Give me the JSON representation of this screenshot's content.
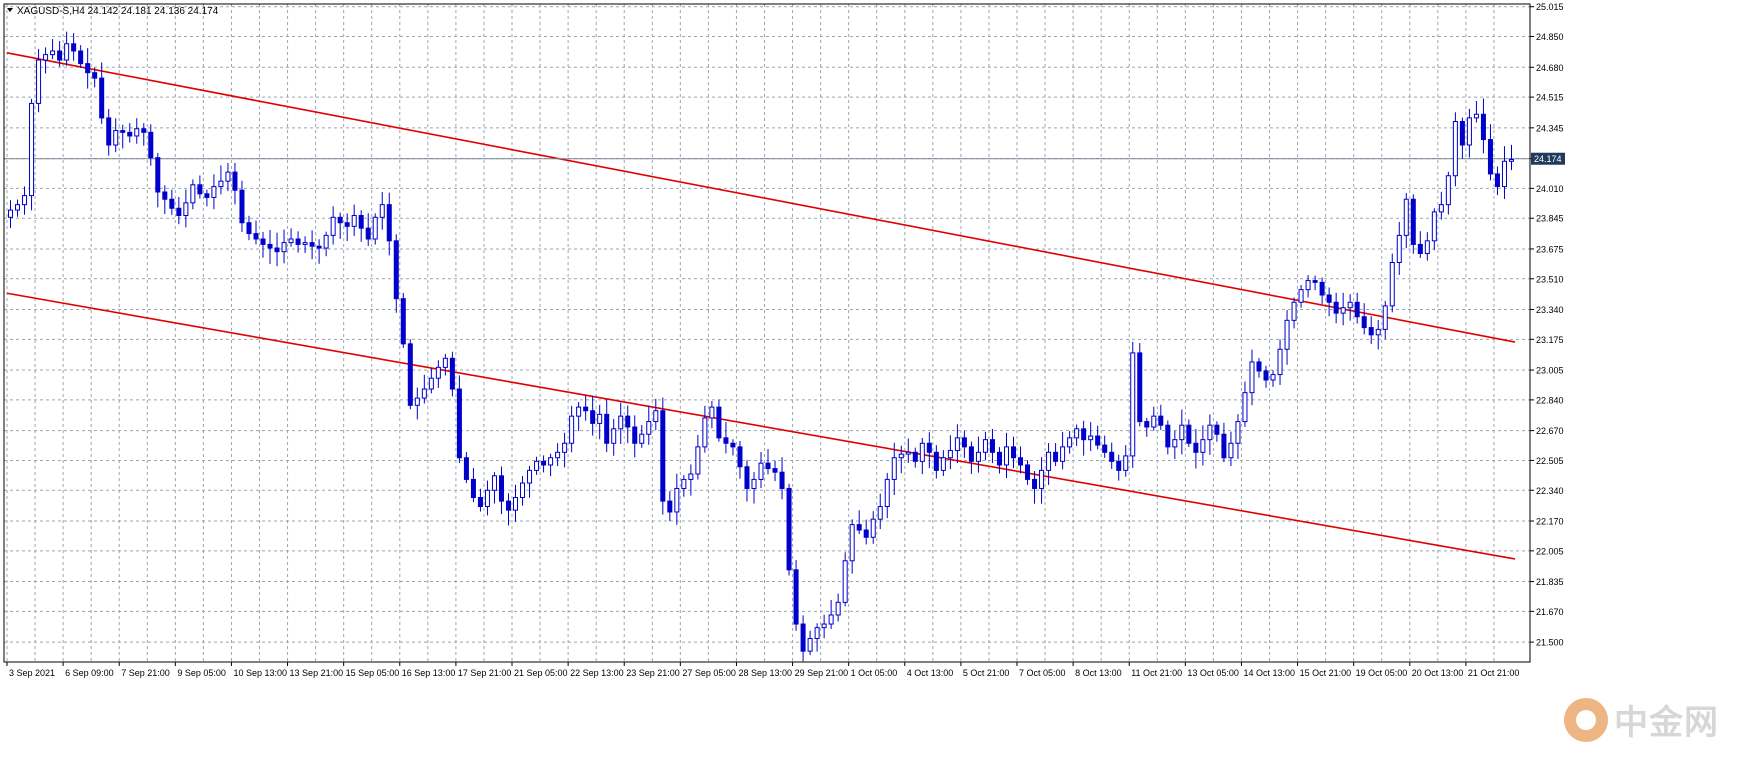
{
  "header": {
    "symbol_text": "XAGUSD-S,H4  24.142 24.181 24.136 24.174",
    "arrow": "triangle-down-icon"
  },
  "current_price_label": "24.174",
  "watermark": {
    "text": "中金网",
    "logo": "cngold-logo-icon"
  },
  "colors": {
    "background": "#ffffff",
    "grid": "#9aa5b1",
    "candle": "#0000cc",
    "trendline": "#e00000",
    "price_line": "#7a8696",
    "price_label_bg": "#1f3a5a",
    "axis_text": "#000000"
  },
  "chart_data": {
    "type": "candlestick",
    "title": "",
    "xlabel": "",
    "ylabel": "",
    "ylim": [
      21.39,
      25.03
    ],
    "grid": true,
    "y_ticks": [
      "25.015",
      "24.850",
      "24.680",
      "24.515",
      "24.345",
      "24.175",
      "24.010",
      "23.845",
      "23.675",
      "23.510",
      "23.340",
      "23.175",
      "23.005",
      "22.840",
      "22.670",
      "22.505",
      "22.340",
      "22.170",
      "22.005",
      "21.835",
      "21.670",
      "21.500"
    ],
    "x_ticks": [
      "3 Sep 2021",
      "6 Sep 09:00",
      "7 Sep 21:00",
      "9 Sep 05:00",
      "10 Sep 13:00",
      "13 Sep 21:00",
      "15 Sep 05:00",
      "16 Sep 13:00",
      "17 Sep 21:00",
      "21 Sep 05:00",
      "22 Sep 13:00",
      "23 Sep 21:00",
      "27 Sep 05:00",
      "28 Sep 13:00",
      "29 Sep 21:00",
      "1 Oct 05:00",
      "4 Oct 13:00",
      "5 Oct 21:00",
      "7 Oct 05:00",
      "8 Oct 13:00",
      "11 Oct 21:00",
      "13 Oct 05:00",
      "14 Oct 13:00",
      "15 Oct 21:00",
      "19 Oct 05:00",
      "20 Oct 13:00",
      "21 Oct 21:00"
    ],
    "x_tick_bar_index": [
      0,
      8,
      16,
      24,
      32,
      40,
      48,
      56,
      64,
      72,
      80,
      88,
      96,
      104,
      112,
      120,
      128,
      136,
      144,
      152,
      160,
      168,
      176,
      184,
      192,
      200,
      208
    ],
    "current_price": 24.174,
    "trendlines": [
      {
        "from": [
          0,
          24.76
        ],
        "to": [
          215,
          23.16
        ]
      },
      {
        "from": [
          0,
          23.43
        ],
        "to": [
          215,
          21.96
        ]
      }
    ],
    "closes": [
      23.89,
      23.92,
      23.97,
      24.48,
      24.72,
      24.75,
      24.77,
      24.72,
      24.81,
      24.77,
      24.7,
      24.65,
      24.62,
      24.4,
      24.25,
      24.33,
      24.32,
      24.3,
      24.34,
      24.32,
      24.18,
      23.99,
      23.95,
      23.9,
      23.86,
      23.93,
      24.03,
      23.98,
      23.96,
      24.02,
      24.05,
      24.1,
      24.0,
      23.82,
      23.76,
      23.73,
      23.7,
      23.68,
      23.66,
      23.71,
      23.73,
      23.7,
      23.71,
      23.69,
      23.68,
      23.75,
      23.85,
      23.82,
      23.8,
      23.86,
      23.79,
      23.73,
      23.85,
      23.92,
      23.72,
      23.4,
      23.15,
      22.81,
      22.85,
      22.9,
      22.96,
      23.02,
      23.07,
      22.9,
      22.52,
      22.4,
      22.3,
      22.25,
      22.34,
      22.42,
      22.28,
      22.23,
      22.3,
      22.38,
      22.45,
      22.5,
      22.48,
      22.52,
      22.55,
      22.6,
      22.75,
      22.8,
      22.78,
      22.71,
      22.76,
      22.6,
      22.68,
      22.75,
      22.69,
      22.6,
      22.65,
      22.72,
      22.78,
      22.28,
      22.22,
      22.35,
      22.4,
      22.43,
      22.58,
      22.74,
      22.8,
      22.63,
      22.6,
      22.58,
      22.47,
      22.35,
      22.4,
      22.49,
      22.46,
      22.44,
      22.35,
      21.9,
      21.6,
      21.45,
      21.52,
      21.58,
      21.6,
      21.65,
      21.72,
      21.95,
      22.15,
      22.12,
      22.08,
      22.18,
      22.25,
      22.4,
      22.52,
      22.54,
      22.55,
      22.5,
      22.6,
      22.55,
      22.45,
      22.52,
      22.56,
      22.63,
      22.58,
      22.5,
      22.55,
      22.62,
      22.55,
      22.48,
      22.58,
      22.52,
      22.48,
      22.4,
      22.35,
      22.45,
      22.55,
      22.5,
      22.58,
      22.63,
      22.68,
      22.62,
      22.64,
      22.59,
      22.55,
      22.5,
      22.45,
      22.53,
      23.1,
      22.72,
      22.69,
      22.75,
      22.7,
      22.58,
      22.62,
      22.7,
      22.6,
      22.55,
      22.62,
      22.7,
      22.65,
      22.52,
      22.6,
      22.72,
      22.88,
      23.05,
      23.0,
      22.95,
      22.98,
      23.12,
      23.28,
      23.38,
      23.45,
      23.5,
      23.49,
      23.42,
      23.38,
      23.32,
      23.35,
      23.38,
      23.3,
      23.24,
      23.2,
      23.23,
      23.36,
      23.6,
      23.75,
      23.95,
      23.7,
      23.65,
      23.72,
      23.88,
      23.92,
      24.08,
      24.38,
      24.25,
      24.4,
      24.42,
      24.28,
      24.09,
      24.02,
      24.16,
      24.17
    ],
    "ohlc_note": ""
  }
}
